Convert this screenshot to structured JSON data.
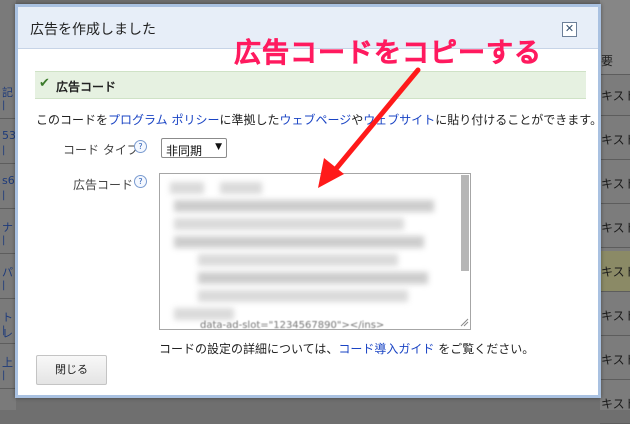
{
  "background": {
    "left_rows": [
      {
        "text": "記"
      },
      {
        "text": "53"
      },
      {
        "text": "s6"
      },
      {
        "text": "ナ"
      },
      {
        "text": "パ"
      },
      {
        "text": "トレ"
      },
      {
        "text": "上"
      }
    ],
    "right_header": "要",
    "right_rows": [
      {
        "text": "キスト",
        "highlight": false
      },
      {
        "text": "キスト",
        "highlight": false
      },
      {
        "text": "キスト",
        "highlight": false
      },
      {
        "text": "キスト",
        "highlight": false
      },
      {
        "text": "キスト",
        "highlight": true
      },
      {
        "text": "キスト",
        "highlight": false
      },
      {
        "text": "キスト",
        "highlight": false
      },
      {
        "text": "キスト",
        "highlight": false
      }
    ]
  },
  "dialog": {
    "title": "広告を作成しました",
    "close_icon": "✕",
    "section": {
      "icon": "check-icon",
      "title": "広告コード"
    },
    "description": {
      "prefix": "このコードを",
      "link1": "プログラム ポリシー",
      "mid1": "に準拠した",
      "link2": "ウェブページ",
      "mid2": "や",
      "link3": "ウェブサイト",
      "suffix": "に貼り付けることができます。"
    },
    "code_type": {
      "label": "コード タイプ",
      "help": "?",
      "value": "非同期",
      "arrow": "▼"
    },
    "ad_code": {
      "label": "広告コード",
      "help": "?",
      "bottom_fragment": "data-ad-slot=\"1234567890\"></ins>"
    },
    "footer": {
      "prefix": "コードの設定の詳細については、",
      "link": "コード導入ガイド",
      "suffix": " をご覧ください。"
    },
    "close_button": "閉じる"
  },
  "annotation": {
    "text": "広告コードをコピーする",
    "color": "#ff1a5f"
  },
  "colors": {
    "link": "#1a44c4",
    "header_bg": "#e7eef8",
    "section_bg": "#e6f1e1",
    "overlay": "#6f6f6f"
  }
}
